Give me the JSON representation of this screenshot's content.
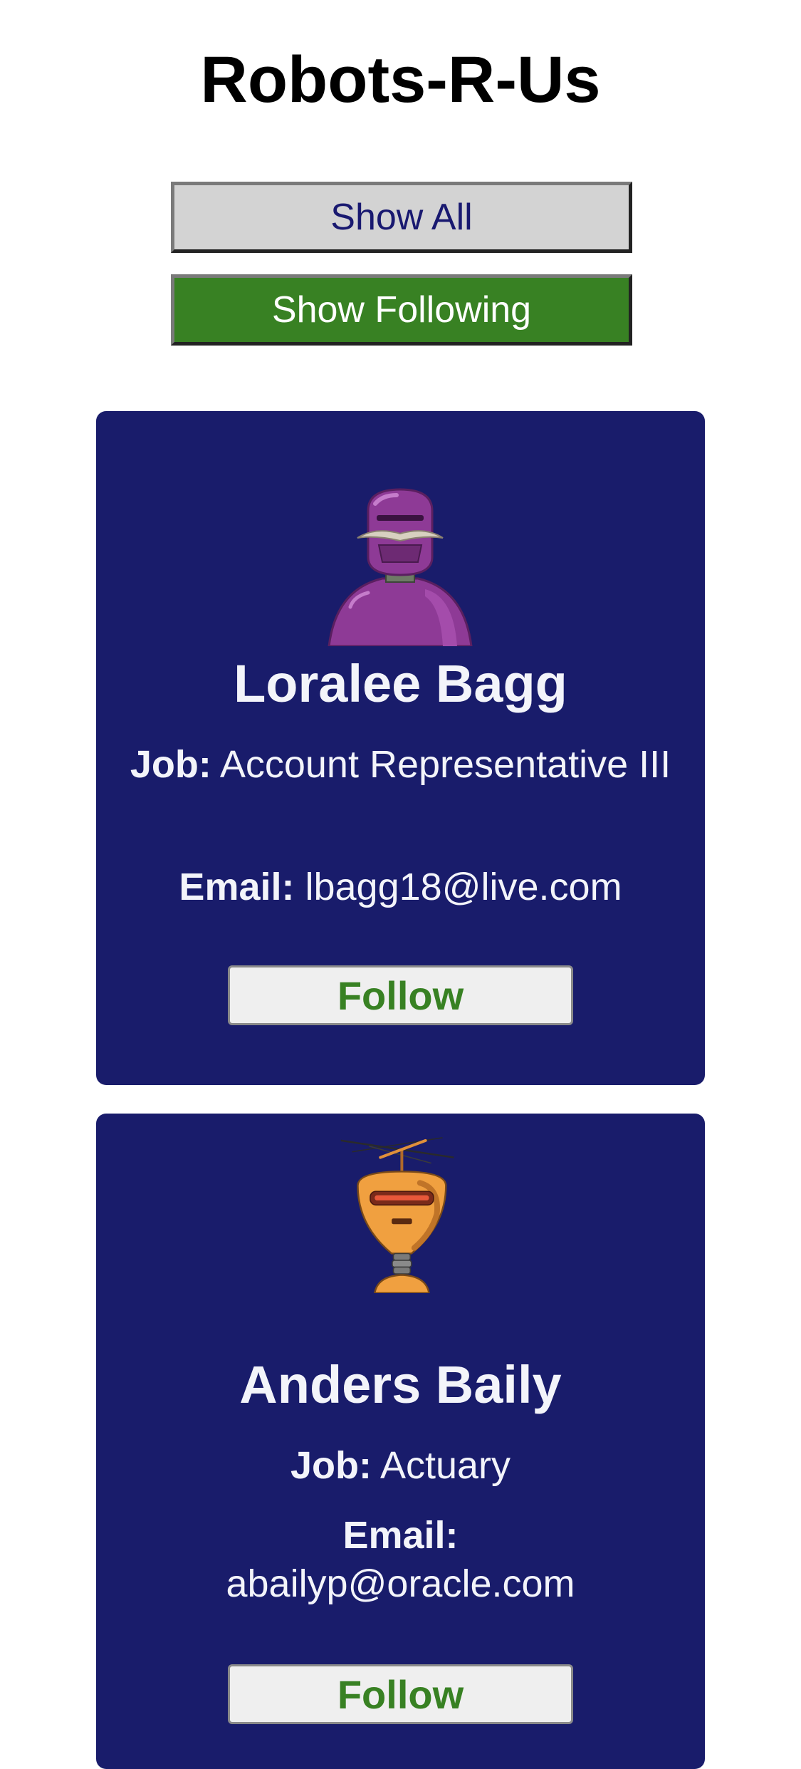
{
  "app": {
    "title": "Robots-R-Us"
  },
  "filters": {
    "show_all_label": "Show All",
    "show_following_label": "Show Following"
  },
  "colors": {
    "card_background": "#191c6b",
    "accent_green": "#388123",
    "title_text": "#000000",
    "card_text": "#f3f4fa"
  },
  "robots": [
    {
      "name": "Loralee Bagg",
      "job_label": "Job:",
      "job": "Account Representative III",
      "email_label": "Email:",
      "email": "lbagg18@live.com",
      "follow_label": "Follow",
      "avatar_icon": "purple-robot-avatar-icon"
    },
    {
      "name": "Anders Baily",
      "job_label": "Job:",
      "job": "Actuary",
      "email_label": "Email:",
      "email": "abailyp@oracle.com",
      "follow_label": "Follow",
      "avatar_icon": "orange-antenna-robot-avatar-icon"
    }
  ]
}
